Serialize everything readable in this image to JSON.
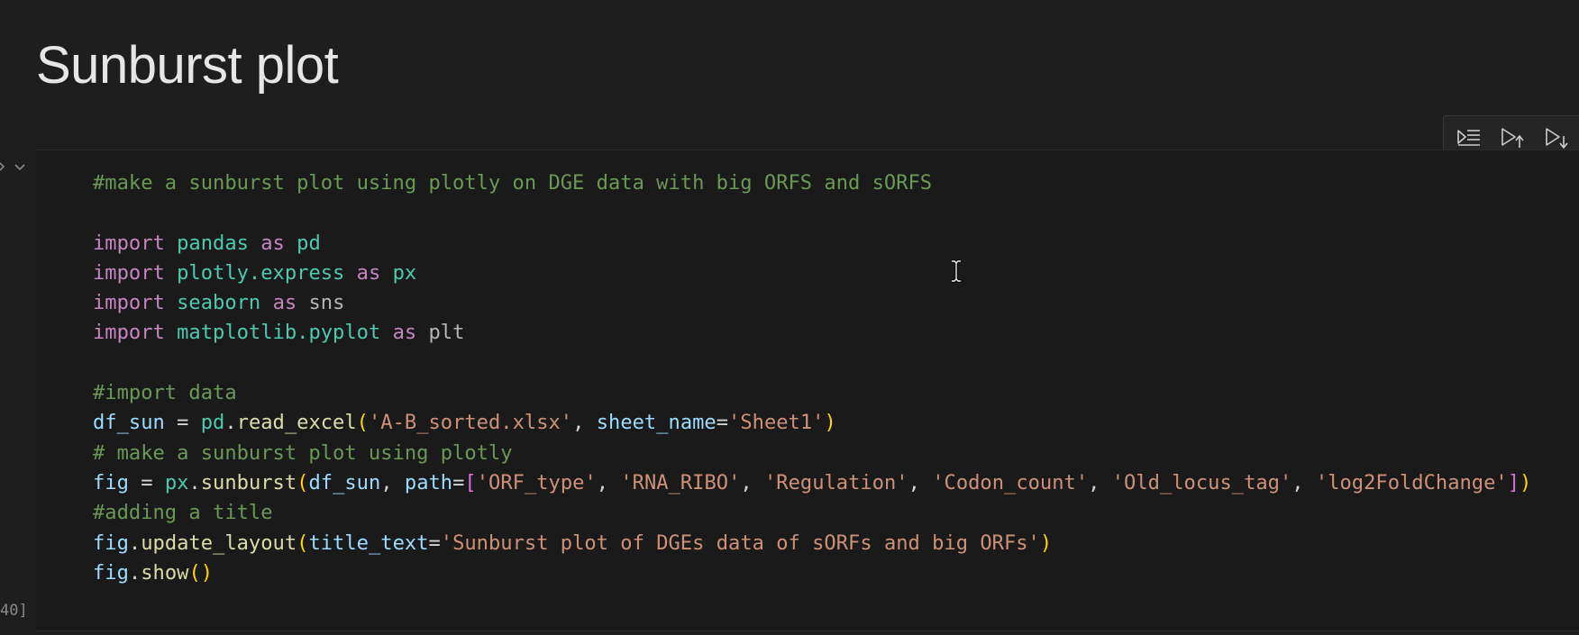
{
  "page": {
    "heading": "Sunburst plot"
  },
  "cell": {
    "execution_count": "40]",
    "toolbar": {
      "buttons": [
        {
          "name": "run-by-line",
          "icon": "run-by-line-icon"
        },
        {
          "name": "execute-above",
          "icon": "execute-above-icon"
        },
        {
          "name": "execute-below",
          "icon": "execute-below-icon"
        }
      ]
    },
    "code_lines": [
      [
        {
          "t": "#make a sunburst plot using plotly on DGE data with big ORFS and sORFS",
          "c": "comment"
        }
      ],
      [],
      [
        {
          "t": "import",
          "c": "keyword"
        },
        {
          "t": " "
        },
        {
          "t": "pandas",
          "c": "module"
        },
        {
          "t": " "
        },
        {
          "t": "as",
          "c": "keyword"
        },
        {
          "t": " "
        },
        {
          "t": "pd",
          "c": "module"
        }
      ],
      [
        {
          "t": "import",
          "c": "keyword"
        },
        {
          "t": " "
        },
        {
          "t": "plotly.express",
          "c": "module"
        },
        {
          "t": " "
        },
        {
          "t": "as",
          "c": "keyword"
        },
        {
          "t": " "
        },
        {
          "t": "px",
          "c": "module"
        }
      ],
      [
        {
          "t": "import",
          "c": "keyword"
        },
        {
          "t": " "
        },
        {
          "t": "seaborn",
          "c": "module"
        },
        {
          "t": " "
        },
        {
          "t": "as",
          "c": "keyword"
        },
        {
          "t": " "
        },
        {
          "t": "sns",
          "c": "dim"
        }
      ],
      [
        {
          "t": "import",
          "c": "keyword"
        },
        {
          "t": " "
        },
        {
          "t": "matplotlib.pyplot",
          "c": "module"
        },
        {
          "t": " "
        },
        {
          "t": "as",
          "c": "keyword"
        },
        {
          "t": " "
        },
        {
          "t": "plt",
          "c": "dim"
        }
      ],
      [],
      [
        {
          "t": "#import data",
          "c": "comment"
        }
      ],
      [
        {
          "t": "df_sun",
          "c": "var"
        },
        {
          "t": " = "
        },
        {
          "t": "pd",
          "c": "module"
        },
        {
          "t": "."
        },
        {
          "t": "read_excel",
          "c": "func"
        },
        {
          "t": "(",
          "c": "paren"
        },
        {
          "t": "'A-B_sorted.xlsx'",
          "c": "string"
        },
        {
          "t": ", "
        },
        {
          "t": "sheet_name",
          "c": "var"
        },
        {
          "t": "="
        },
        {
          "t": "'Sheet1'",
          "c": "string"
        },
        {
          "t": ")",
          "c": "paren"
        }
      ],
      [
        {
          "t": "# make a sunburst plot using plotly",
          "c": "comment"
        }
      ],
      [
        {
          "t": "fig",
          "c": "var"
        },
        {
          "t": " = "
        },
        {
          "t": "px",
          "c": "module"
        },
        {
          "t": "."
        },
        {
          "t": "sunburst",
          "c": "func"
        },
        {
          "t": "(",
          "c": "paren"
        },
        {
          "t": "df_sun",
          "c": "var"
        },
        {
          "t": ", "
        },
        {
          "t": "path",
          "c": "var"
        },
        {
          "t": "="
        },
        {
          "t": "[",
          "c": "bracket"
        },
        {
          "t": "'ORF_type'",
          "c": "string"
        },
        {
          "t": ", "
        },
        {
          "t": "'RNA_RIBO'",
          "c": "string"
        },
        {
          "t": ", "
        },
        {
          "t": "'Regulation'",
          "c": "string"
        },
        {
          "t": ", "
        },
        {
          "t": "'Codon_count'",
          "c": "string"
        },
        {
          "t": ", "
        },
        {
          "t": "'Old_locus_tag'",
          "c": "string"
        },
        {
          "t": ", "
        },
        {
          "t": "'log2FoldChange'",
          "c": "string"
        },
        {
          "t": "]",
          "c": "bracket"
        },
        {
          "t": ")",
          "c": "paren"
        }
      ],
      [
        {
          "t": "#adding a title",
          "c": "comment"
        }
      ],
      [
        {
          "t": "fig",
          "c": "var"
        },
        {
          "t": "."
        },
        {
          "t": "update_layout",
          "c": "func"
        },
        {
          "t": "(",
          "c": "paren"
        },
        {
          "t": "title_text",
          "c": "var"
        },
        {
          "t": "="
        },
        {
          "t": "'Sunburst plot of DGEs data of sORFs and big ORFs'",
          "c": "string"
        },
        {
          "t": ")",
          "c": "paren"
        }
      ],
      [
        {
          "t": "fig",
          "c": "var"
        },
        {
          "t": "."
        },
        {
          "t": "show",
          "c": "func"
        },
        {
          "t": "()",
          "c": "paren"
        }
      ]
    ]
  }
}
